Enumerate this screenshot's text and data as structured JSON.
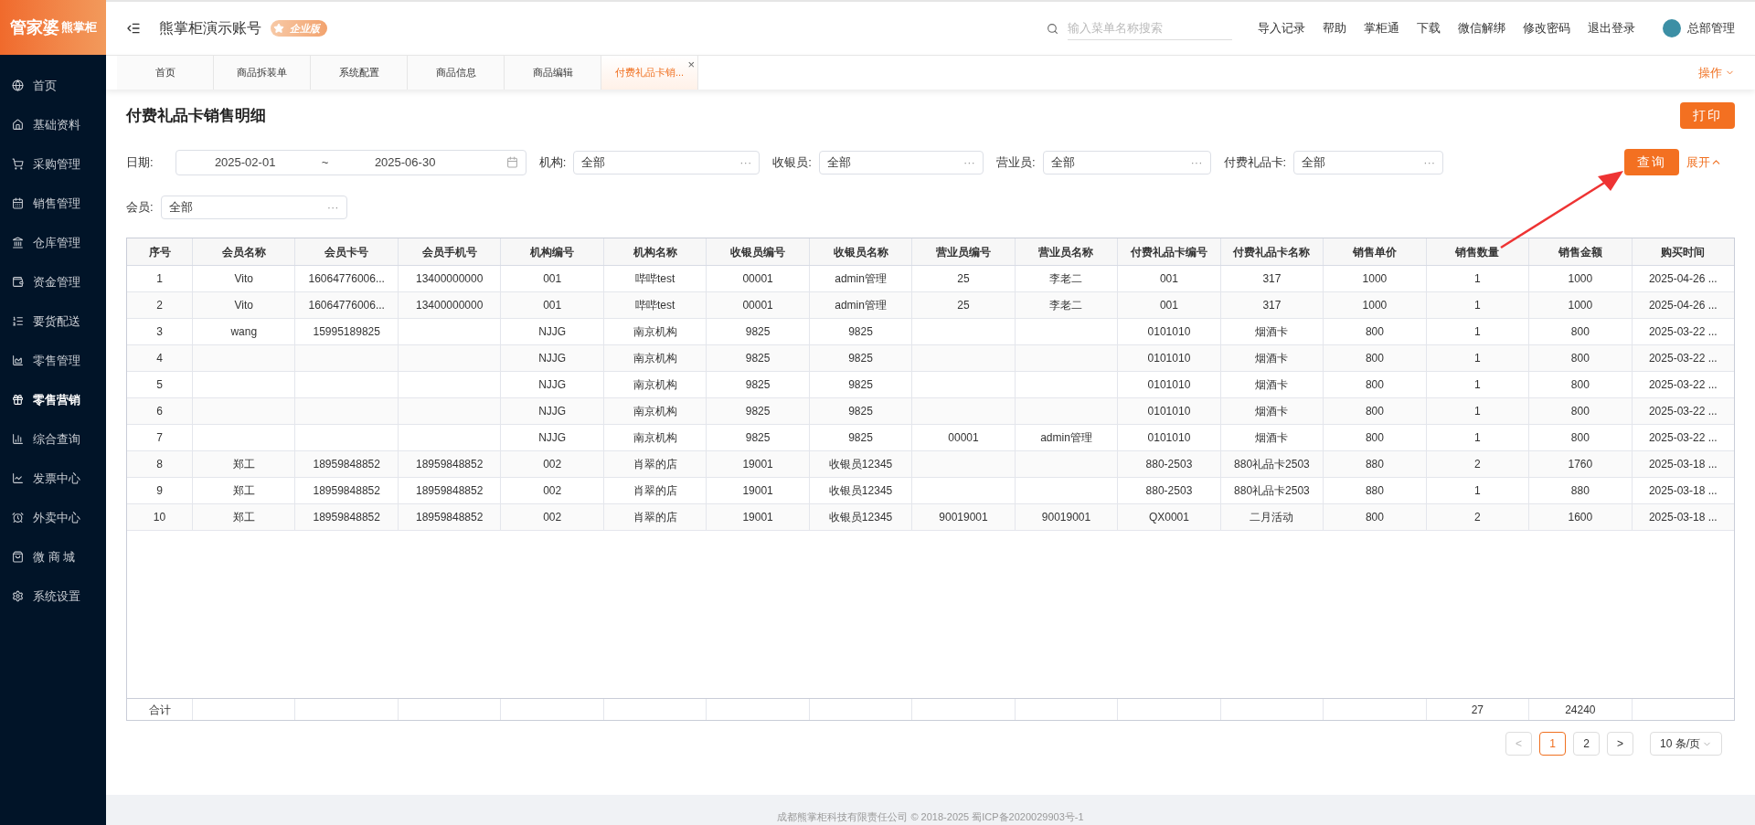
{
  "brand": {
    "main": "管家婆",
    "sub": "熊掌柜"
  },
  "header": {
    "account": "熊掌柜演示账号",
    "edition": "企业版",
    "search": {
      "placeholder": "输入菜单名称搜索"
    },
    "links": [
      "导入记录",
      "帮助",
      "掌柜通",
      "下载",
      "微信解绑",
      "修改密码",
      "退出登录"
    ],
    "user": "总部管理"
  },
  "sidebar": {
    "items": [
      {
        "label": "首页",
        "selected": false
      },
      {
        "label": "基础资料",
        "selected": false
      },
      {
        "label": "采购管理",
        "selected": false
      },
      {
        "label": "销售管理",
        "selected": false
      },
      {
        "label": "仓库管理",
        "selected": false
      },
      {
        "label": "资金管理",
        "selected": false
      },
      {
        "label": "要货配送",
        "selected": false
      },
      {
        "label": "零售管理",
        "selected": false
      },
      {
        "label": "零售营销",
        "selected": true
      },
      {
        "label": "综合查询",
        "selected": false
      },
      {
        "label": "发票中心",
        "selected": false
      },
      {
        "label": "外卖中心",
        "selected": false
      },
      {
        "label": "微 商 城",
        "selected": false
      },
      {
        "label": "系统设置",
        "selected": false
      }
    ]
  },
  "tabs": [
    {
      "label": "首页",
      "selected": false
    },
    {
      "label": "商品拆装单",
      "selected": false
    },
    {
      "label": "系统配置",
      "selected": false
    },
    {
      "label": "商品信息",
      "selected": false
    },
    {
      "label": "商品编辑",
      "selected": false
    },
    {
      "label": "付费礼品卡销...",
      "selected": true,
      "close": "×"
    }
  ],
  "tab_actions": "操作",
  "page": {
    "title": "付费礼品卡销售明细",
    "print_button": "打印"
  },
  "filters": {
    "date": {
      "label": "日期:",
      "start": "2025-02-01",
      "separator": "~",
      "end": "2025-06-30"
    },
    "selects": [
      {
        "label": "机构:",
        "value": "全部",
        "more": "···"
      },
      {
        "label": "收银员:",
        "value": "全部",
        "more": "···"
      },
      {
        "label": "营业员:",
        "value": "全部",
        "more": "···"
      },
      {
        "label": "付费礼品卡:",
        "value": "全部",
        "more": "···"
      }
    ],
    "query_button": "查询",
    "expand_link": "展开",
    "member": {
      "label": "会员:",
      "value": "全部",
      "more": "···"
    }
  },
  "table": {
    "columns": [
      "序号",
      "会员名称",
      "会员卡号",
      "会员手机号",
      "机构编号",
      "机构名称",
      "收银员编号",
      "收银员名称",
      "营业员编号",
      "营业员名称",
      "付费礼品卡编号",
      "付费礼品卡名称",
      "销售单价",
      "销售数量",
      "销售金额",
      "购买时间"
    ],
    "rows": [
      [
        "1",
        "Vito",
        "16064776006...",
        "13400000000",
        "001",
        "哔哔test",
        "00001",
        "admin管理",
        "25",
        "李老二",
        "001",
        "317",
        "1000",
        "1",
        "1000",
        "2025-04-26 ..."
      ],
      [
        "2",
        "Vito",
        "16064776006...",
        "13400000000",
        "001",
        "哔哔test",
        "00001",
        "admin管理",
        "25",
        "李老二",
        "001",
        "317",
        "1000",
        "1",
        "1000",
        "2025-04-26 ..."
      ],
      [
        "3",
        "wang",
        "15995189825",
        null,
        "NJJG",
        "南京机构",
        "9825",
        "9825",
        null,
        null,
        "0101010",
        "烟酒卡",
        "800",
        "1",
        "800",
        "2025-03-22 ..."
      ],
      [
        "4",
        null,
        null,
        null,
        "NJJG",
        "南京机构",
        "9825",
        "9825",
        null,
        null,
        "0101010",
        "烟酒卡",
        "800",
        "1",
        "800",
        "2025-03-22 ..."
      ],
      [
        "5",
        null,
        null,
        null,
        "NJJG",
        "南京机构",
        "9825",
        "9825",
        null,
        null,
        "0101010",
        "烟酒卡",
        "800",
        "1",
        "800",
        "2025-03-22 ..."
      ],
      [
        "6",
        null,
        null,
        null,
        "NJJG",
        "南京机构",
        "9825",
        "9825",
        null,
        null,
        "0101010",
        "烟酒卡",
        "800",
        "1",
        "800",
        "2025-03-22 ..."
      ],
      [
        "7",
        null,
        null,
        null,
        "NJJG",
        "南京机构",
        "9825",
        "9825",
        "00001",
        "admin管理",
        "0101010",
        "烟酒卡",
        "800",
        "1",
        "800",
        "2025-03-22 ..."
      ],
      [
        "8",
        "郑工",
        "18959848852",
        "18959848852",
        "002",
        "肖翠的店",
        "19001",
        "收银员12345",
        null,
        null,
        "880-2503",
        "880礼品卡2503",
        "880",
        "2",
        "1760",
        "2025-03-18 ..."
      ],
      [
        "9",
        "郑工",
        "18959848852",
        "18959848852",
        "002",
        "肖翠的店",
        "19001",
        "收银员12345",
        null,
        null,
        "880-2503",
        "880礼品卡2503",
        "880",
        "1",
        "880",
        "2025-03-18 ..."
      ],
      [
        "10",
        "郑工",
        "18959848852",
        "18959848852",
        "002",
        "肖翠的店",
        "19001",
        "收银员12345",
        "90019001",
        "90019001",
        "QX0001",
        "二月活动",
        "800",
        "2",
        "1600",
        "2025-03-18 ..."
      ]
    ],
    "summary": {
      "label": "合计",
      "quantity_total": "27",
      "amount_total": "24240"
    }
  },
  "pagination": {
    "prev": "<",
    "pages": [
      {
        "label": "1",
        "selected": true
      },
      {
        "label": "2",
        "selected": false
      }
    ],
    "next": ">",
    "page_size": "10 条/页"
  },
  "footer": "成都熊掌柜科技有限责任公司 © 2018-2025 蜀ICP备2020029903号-1"
}
